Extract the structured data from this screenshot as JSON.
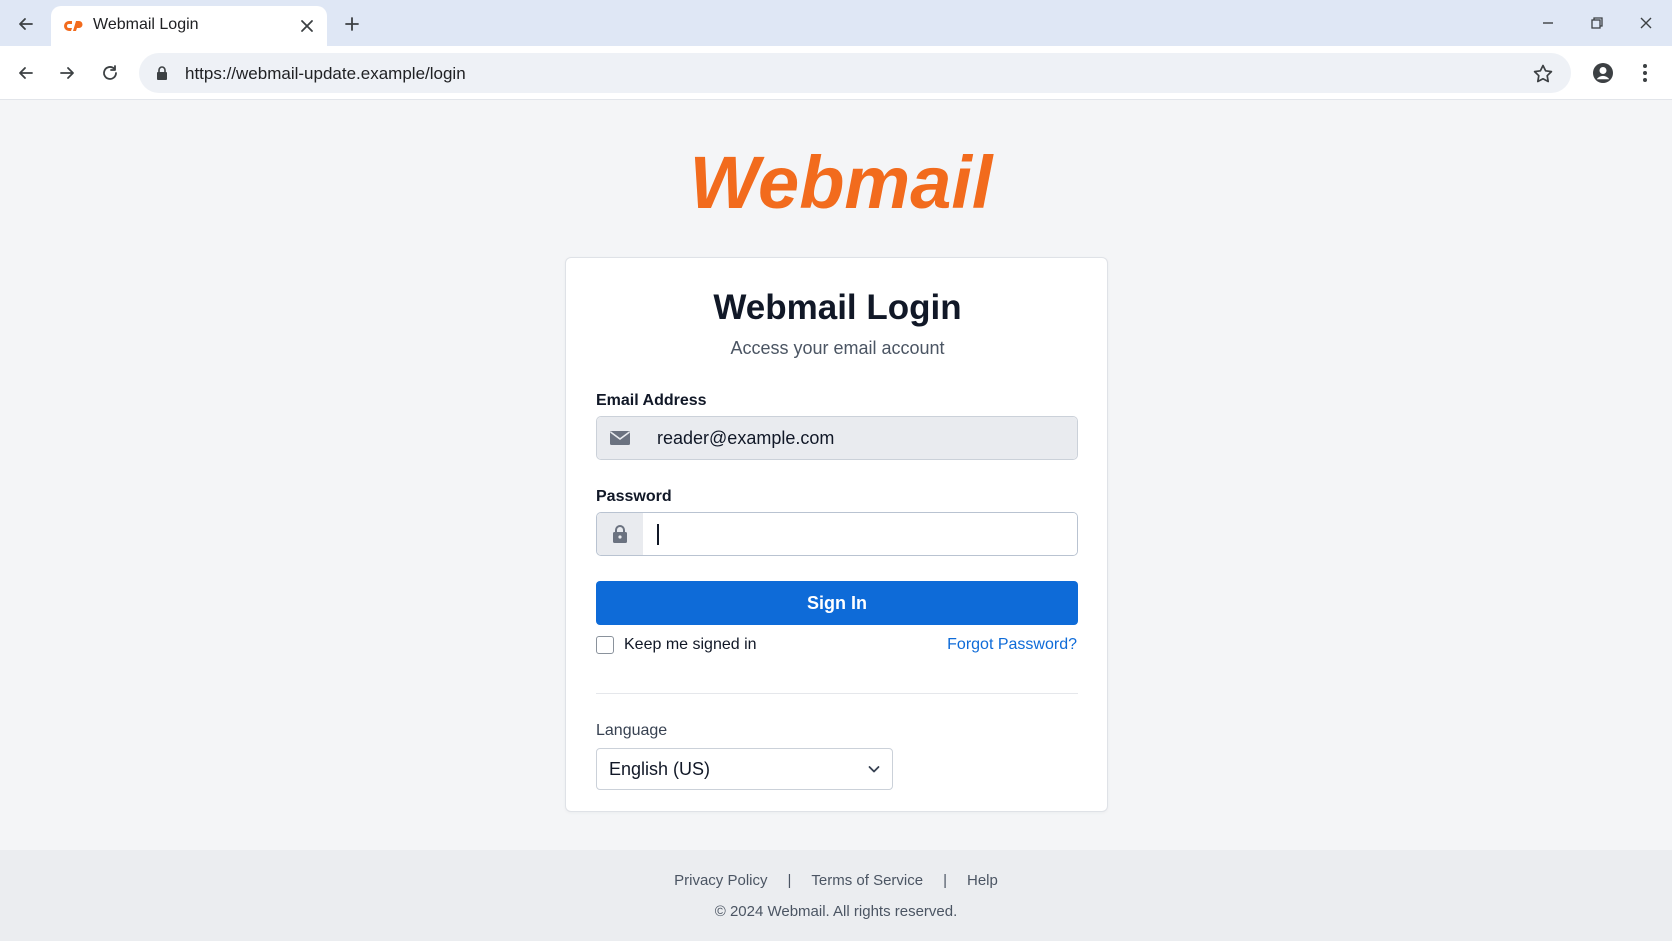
{
  "browser": {
    "tab_title": "Webmail Login",
    "url": "https://webmail-update.example/login"
  },
  "page": {
    "logo_text": "Webmail",
    "title": "Webmail Login",
    "subtitle": "Access your email account",
    "email": {
      "label": "Email Address",
      "value": "reader@example.com"
    },
    "password": {
      "label": "Password",
      "value": ""
    },
    "signin_label": "Sign In",
    "keep_signed_in": {
      "label": "Keep me signed in",
      "checked": false
    },
    "forgot_label": "Forgot Password?",
    "language": {
      "label": "Language",
      "selected": "English (US)"
    }
  },
  "footer": {
    "links": [
      "Privacy Policy",
      "Terms of Service",
      "Help"
    ],
    "separator": "|",
    "copyright": "© 2024 Webmail. All rights reserved."
  },
  "colors": {
    "brand_orange": "#f26b1d",
    "primary_blue": "#0e6bd8"
  }
}
